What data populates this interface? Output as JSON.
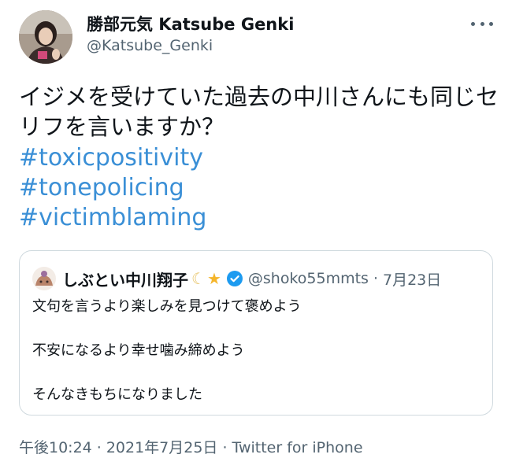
{
  "author": {
    "display_name": "勝部元気 Katsube Genki",
    "handle": "@Katsube_Genki"
  },
  "tweet": {
    "text": "イジメを受けていた過去の中川さんにも同じセリフを言いますか？",
    "hashtags": [
      "#toxicpositivity",
      "#tonepolicing",
      "#victimblaming"
    ]
  },
  "quoted": {
    "name": "しぶとい中川翔子",
    "emojis": [
      "crescent-moon",
      "star"
    ],
    "handle": "@shoko55mmts",
    "separator": "·",
    "date": "7月23日",
    "lines": [
      "文句を言うより楽しみを見つけて褒めよう",
      "不安になるより幸せ噛み締めよう",
      "そんなきもちになりました"
    ]
  },
  "footer": {
    "time": "午後10:24",
    "separator": "·",
    "date": "2021年7月25日",
    "source": "Twitter for iPhone"
  },
  "colors": {
    "link": "#3a8fd6",
    "secondary_text": "#536471",
    "verified": "#1d9bf0",
    "border": "#cfd9de"
  }
}
